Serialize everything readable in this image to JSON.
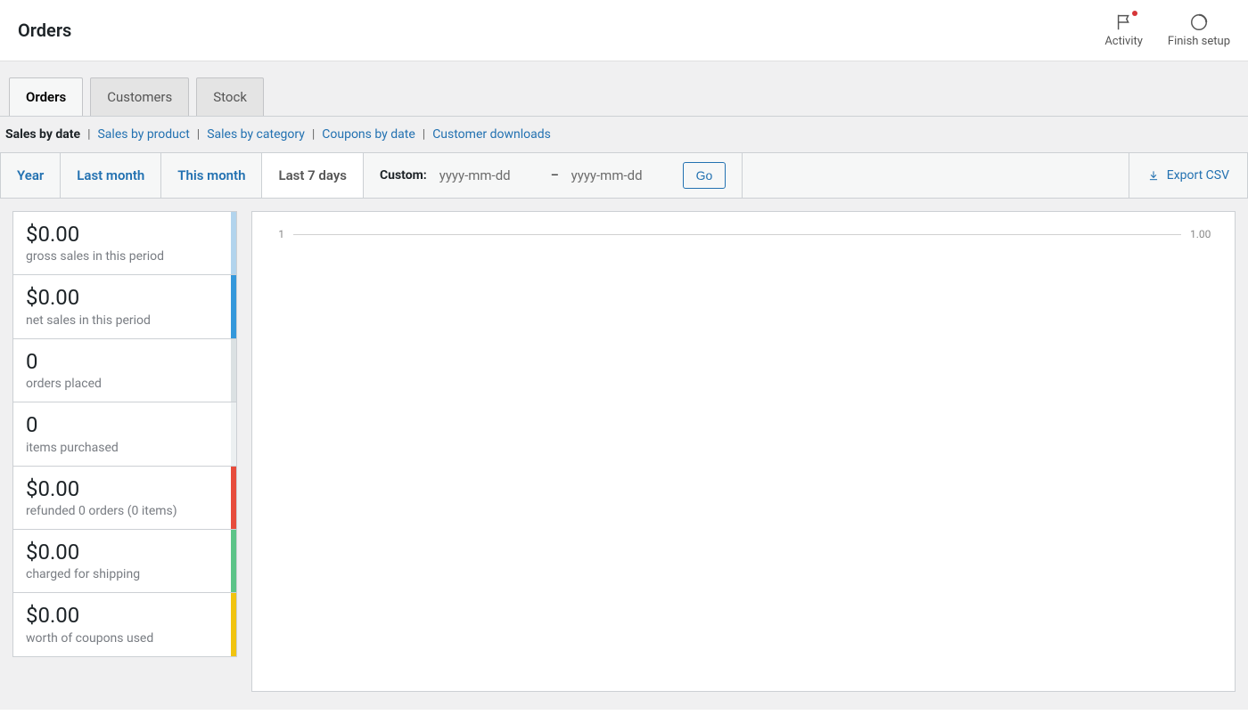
{
  "header": {
    "title": "Orders",
    "activity_label": "Activity",
    "finish_setup_label": "Finish setup"
  },
  "tabs": {
    "primary": [
      {
        "label": "Orders",
        "active": true
      },
      {
        "label": "Customers",
        "active": false
      },
      {
        "label": "Stock",
        "active": false
      }
    ]
  },
  "subnav": {
    "items": [
      {
        "label": "Sales by date",
        "current": true
      },
      {
        "label": "Sales by product",
        "current": false
      },
      {
        "label": "Sales by category",
        "current": false
      },
      {
        "label": "Coupons by date",
        "current": false
      },
      {
        "label": "Customer downloads",
        "current": false
      }
    ]
  },
  "range": {
    "tabs": [
      {
        "label": "Year",
        "active": false
      },
      {
        "label": "Last month",
        "active": false
      },
      {
        "label": "This month",
        "active": false
      },
      {
        "label": "Last 7 days",
        "active": true
      }
    ],
    "custom_label": "Custom:",
    "from_placeholder": "yyyy-mm-dd",
    "to_placeholder": "yyyy-mm-dd",
    "from_value": "",
    "to_value": "",
    "go_label": "Go",
    "export_label": "Export CSV"
  },
  "stats": [
    {
      "value": "$0.00",
      "label": "gross sales in this period",
      "stripe": "#b2d4ed"
    },
    {
      "value": "$0.00",
      "label": "net sales in this period",
      "stripe": "#3498db"
    },
    {
      "value": "0",
      "label": "orders placed",
      "stripe": "#dbe1e3"
    },
    {
      "value": "0",
      "label": "items purchased",
      "stripe": "#ecf0f1"
    },
    {
      "value": "$0.00",
      "label": "refunded 0 orders (0 items)",
      "stripe": "#e74c3c"
    },
    {
      "value": "$0.00",
      "label": "charged for shipping",
      "stripe": "#5cc488"
    },
    {
      "value": "$0.00",
      "label": "worth of coupons used",
      "stripe": "#f1c40f"
    }
  ],
  "chart_data": {
    "type": "line",
    "title": "",
    "xlabel": "",
    "ylabel": "",
    "x_ticks": [
      "1"
    ],
    "x_tick_right": "1.00",
    "series": [
      {
        "name": "gross sales in this period",
        "values": []
      },
      {
        "name": "net sales in this period",
        "values": []
      },
      {
        "name": "orders placed",
        "values": []
      },
      {
        "name": "items purchased",
        "values": []
      },
      {
        "name": "refunded",
        "values": []
      },
      {
        "name": "charged for shipping",
        "values": []
      },
      {
        "name": "worth of coupons used",
        "values": []
      }
    ]
  }
}
